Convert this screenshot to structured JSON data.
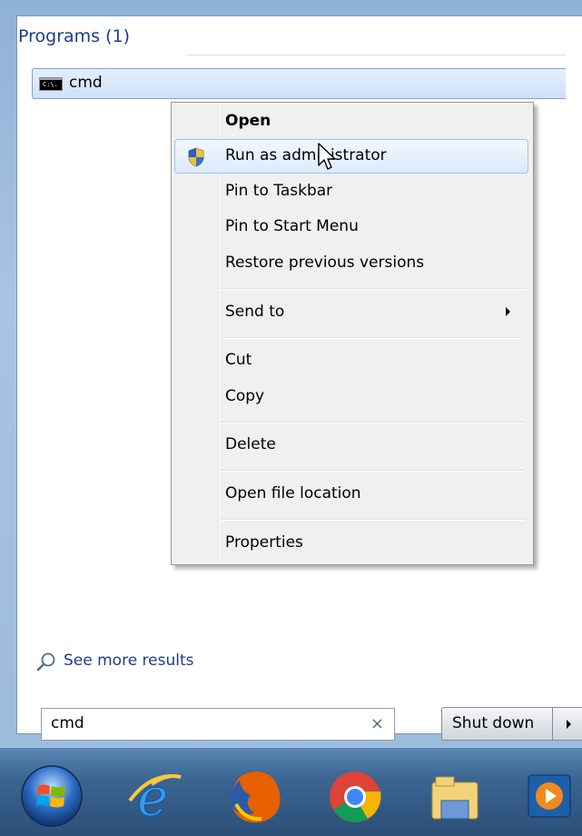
{
  "start_menu": {
    "programs_header": "Programs (1)",
    "result": {
      "label": "cmd",
      "icon_text": "C:\\."
    },
    "see_more_label": "See more results",
    "search": {
      "value": "cmd",
      "clear_glyph": "×"
    },
    "shutdown_label": "Shut down"
  },
  "context_menu": {
    "items": [
      {
        "label": "Open",
        "bold": true
      },
      {
        "label": "Run as administrator",
        "icon": "uac-shield-icon",
        "hovered": true
      },
      {
        "label": "Pin to Taskbar"
      },
      {
        "label": "Pin to Start Menu"
      },
      {
        "label": "Restore previous versions"
      },
      {
        "label": "Send to",
        "submenu": true
      },
      {
        "label": "Cut"
      },
      {
        "label": "Copy"
      },
      {
        "label": "Delete"
      },
      {
        "label": "Open file location"
      },
      {
        "label": "Properties"
      }
    ]
  },
  "taskbar": {
    "icons": [
      "windows-start-orb-icon",
      "internet-explorer-icon",
      "firefox-icon",
      "chrome-icon",
      "file-explorer-icon",
      "media-player-icon"
    ]
  },
  "colors": {
    "accent": "#1e3d8a",
    "hover_border": "#9cc4ee",
    "taskbar": "#2b4f78"
  }
}
